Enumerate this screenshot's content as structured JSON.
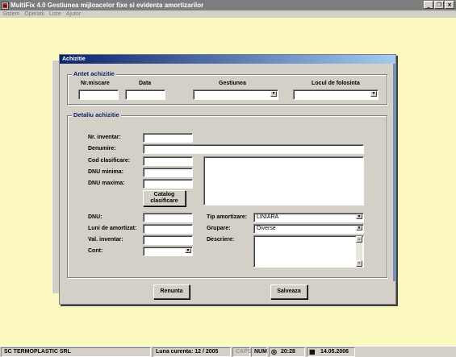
{
  "window": {
    "title": "MultiFix 4.0    Gestiunea mijloacelor fixe si evidenta amortizarilor",
    "min_label": "_",
    "restore_label": "❐",
    "close_label": "×"
  },
  "menu": [
    "Sistem",
    "Operatii",
    "Liste",
    "Ajutor"
  ],
  "dialog": {
    "title": "Achizitie",
    "header": {
      "legend": "Antet achizitie",
      "nr_miscare_label": "Nr.miscare",
      "data_label": "Data",
      "gestiunea_label": "Gestiunea",
      "locul_label": "Locul de folosinta",
      "nr_miscare_value": "",
      "data_value": "",
      "gestiunea_value": "",
      "locul_value": ""
    },
    "detail": {
      "legend": "Detaliu achizitie",
      "nr_inventar_label": "Nr. inventar:",
      "denumire_label": "Denumire:",
      "cod_clasificare_label": "Cod clasificare:",
      "dnu_minima_label": "DNU minima:",
      "dnu_maxima_label": "DNU maxima:",
      "catalog_button": "Catalog clasificare",
      "dnu_label": "DNU:",
      "luni_label": "Luni de amortizat:",
      "val_inventar_label": "Val. inventar:",
      "cont_label": "Cont:",
      "tip_amortizare_label": "Tip amortizare:",
      "tip_amortizare_value": "LINIARA",
      "grupare_label": "Grupare:",
      "grupare_value": "Diverse",
      "descriere_label": "Descriere:",
      "nr_inventar_value": "",
      "denumire_value": "",
      "cod_clasificare_value": "",
      "dnu_minima_value": "",
      "dnu_maxima_value": "",
      "dnu_value": "",
      "luni_value": "",
      "val_inventar_value": "",
      "cont_value": "",
      "descriere_value": ""
    },
    "buttons": {
      "renunta": "Renunta",
      "salveaza": "Salveaza"
    }
  },
  "statusbar": {
    "company": "SC TERMOPLASTIC SRL",
    "luna_curenta": "Luna curenta: 12 / 2005",
    "caps": "CAPS",
    "num": "NUM",
    "time": "20:28",
    "date": "14.05.2006"
  },
  "icons": {
    "app": "multifix-app-icon",
    "clock": "clock-icon",
    "calendar": "calendar-icon",
    "dropdown": "chevron-down-icon"
  }
}
